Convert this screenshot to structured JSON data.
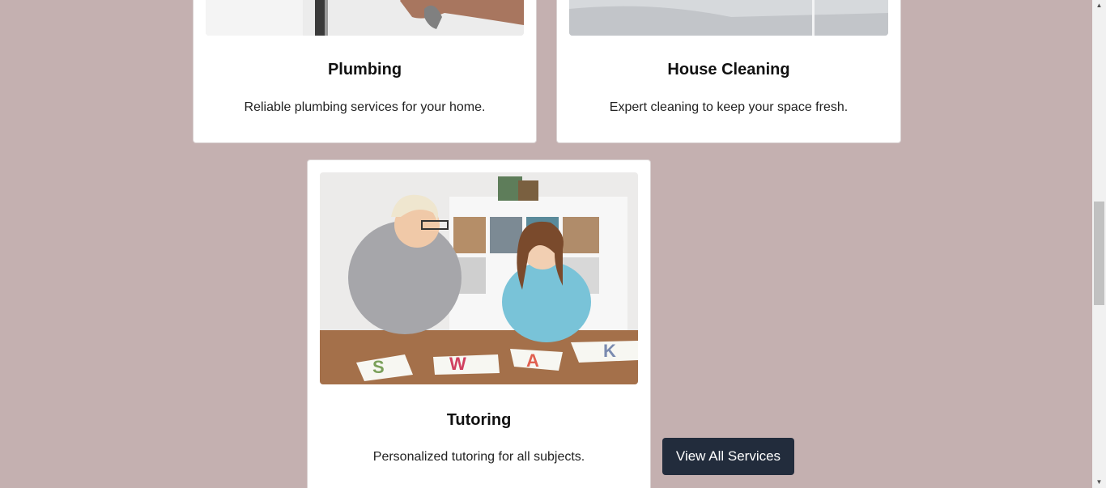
{
  "services": [
    {
      "title": "Plumbing",
      "description": "Reliable plumbing services for your home."
    },
    {
      "title": "House Cleaning",
      "description": "Expert cleaning to keep your space fresh."
    },
    {
      "title": "Tutoring",
      "description": "Personalized tutoring for all subjects."
    }
  ],
  "actions": {
    "view_all_label": "View All Services"
  },
  "scrollbar": {
    "up_icon": "▲",
    "down_icon": "▼"
  },
  "colors": {
    "page_background": "#c4b0b0",
    "button_background": "#222c3c",
    "card_background": "#ffffff"
  }
}
